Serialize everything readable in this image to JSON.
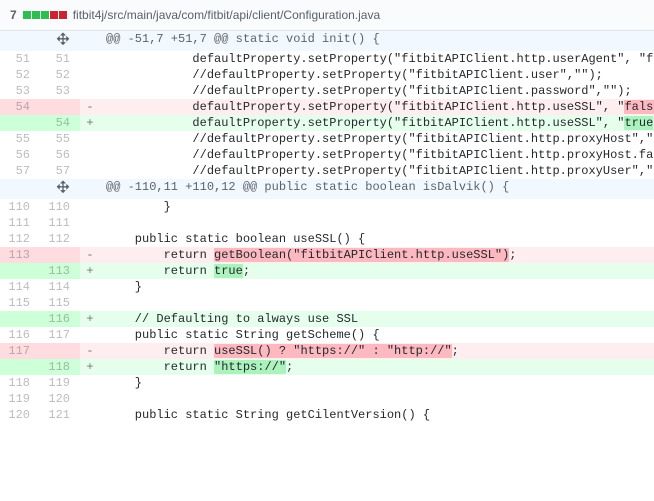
{
  "header": {
    "change_count": "7",
    "file_path": "fitbit4j/src/main/java/com/fitbit/api/client/Configuration.java"
  },
  "hunks": [
    {
      "header": "@@ -51,7 +51,7 @@ static void init() {",
      "lines": [
        {
          "type": "ctx",
          "old": "51",
          "new": "51",
          "code": "            defaultProperty.setProperty(\"fitbitAPIClient.http.userAgent\", \"fitbi"
        },
        {
          "type": "ctx",
          "old": "52",
          "new": "52",
          "code": "            //defaultProperty.setProperty(\"fitbitAPIClient.user\",\"\");"
        },
        {
          "type": "ctx",
          "old": "53",
          "new": "53",
          "code": "            //defaultProperty.setProperty(\"fitbitAPIClient.password\",\"\");"
        },
        {
          "type": "del",
          "old": "54",
          "new": "",
          "code": "            defaultProperty.setProperty(\"fitbitAPIClient.http.useSSL\", \"",
          "hl": "false",
          "code_after": "\");"
        },
        {
          "type": "add",
          "old": "",
          "new": "54",
          "code": "            defaultProperty.setProperty(\"fitbitAPIClient.http.useSSL\", \"",
          "hl": "true",
          "code_after": "\");"
        },
        {
          "type": "ctx",
          "old": "55",
          "new": "55",
          "code": "            //defaultProperty.setProperty(\"fitbitAPIClient.http.proxyHost\",\"\");"
        },
        {
          "type": "ctx",
          "old": "56",
          "new": "56",
          "code": "            //defaultProperty.setProperty(\"fitbitAPIClient.http.proxyHost.fallback"
        },
        {
          "type": "ctx",
          "old": "57",
          "new": "57",
          "code": "            //defaultProperty.setProperty(\"fitbitAPIClient.http.proxyUser\",\"\");"
        }
      ]
    },
    {
      "header": "@@ -110,11 +110,12 @@ public static boolean isDalvik() {",
      "lines": [
        {
          "type": "ctx",
          "old": "110",
          "new": "110",
          "code": "        }"
        },
        {
          "type": "ctx",
          "old": "111",
          "new": "111",
          "code": ""
        },
        {
          "type": "ctx",
          "old": "112",
          "new": "112",
          "code": "    public static boolean useSSL() {"
        },
        {
          "type": "del",
          "old": "113",
          "new": "",
          "code": "        return ",
          "hl": "getBoolean(\"fitbitAPIClient.http.useSSL\")",
          "code_after": ";"
        },
        {
          "type": "add",
          "old": "",
          "new": "113",
          "code": "        return ",
          "hl": "true",
          "code_after": ";"
        },
        {
          "type": "ctx",
          "old": "114",
          "new": "114",
          "code": "    }"
        },
        {
          "type": "ctx",
          "old": "115",
          "new": "115",
          "code": ""
        },
        {
          "type": "add",
          "old": "",
          "new": "116",
          "code": "    // Defaulting to always use SSL"
        },
        {
          "type": "ctx",
          "old": "116",
          "new": "117",
          "code": "    public static String getScheme() {"
        },
        {
          "type": "del",
          "old": "117",
          "new": "",
          "code": "        return ",
          "hl": "useSSL() ? \"https://\" : \"http://\"",
          "code_after": ";"
        },
        {
          "type": "add",
          "old": "",
          "new": "118",
          "code": "        return ",
          "hl": "\"https://\"",
          "code_after": ";"
        },
        {
          "type": "ctx",
          "old": "118",
          "new": "119",
          "code": "    }"
        },
        {
          "type": "ctx",
          "old": "119",
          "new": "120",
          "code": ""
        },
        {
          "type": "ctx",
          "old": "120",
          "new": "121",
          "code": "    public static String getCilentVersion() {"
        }
      ]
    }
  ]
}
